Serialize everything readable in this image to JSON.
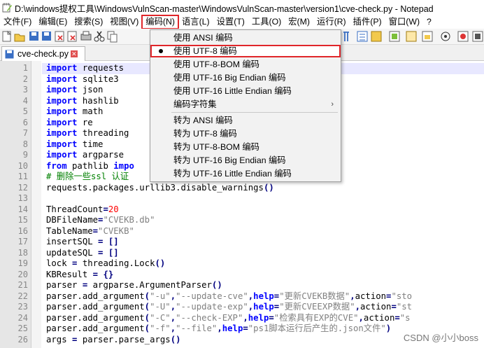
{
  "window": {
    "title": "D:\\windows提权工具\\WindowsVulnScan-master\\WindowsVulnScan-master\\version1\\cve-check.py - Notepad"
  },
  "menubar": {
    "items": [
      {
        "label": "文件(F)"
      },
      {
        "label": "编辑(E)"
      },
      {
        "label": "搜索(S)"
      },
      {
        "label": "视图(V)"
      },
      {
        "label": "编码(N)",
        "active": true
      },
      {
        "label": "语言(L)"
      },
      {
        "label": "设置(T)"
      },
      {
        "label": "工具(O)"
      },
      {
        "label": "宏(M)"
      },
      {
        "label": "运行(R)"
      },
      {
        "label": "插件(P)"
      },
      {
        "label": "窗口(W)"
      },
      {
        "label": "?"
      }
    ]
  },
  "tab": {
    "label": "cve-check.py",
    "close_glyph": "✕"
  },
  "encoding_menu": {
    "items": [
      {
        "label": "使用 ANSI 编码"
      },
      {
        "label": "使用 UTF-8 编码",
        "checked": true
      },
      {
        "label": "使用 UTF-8-BOM 编码"
      },
      {
        "label": "使用 UTF-16 Big Endian 编码"
      },
      {
        "label": "使用 UTF-16 Little Endian 编码"
      },
      {
        "label": "编码字符集",
        "submenu": true
      },
      {
        "label": "转为 ANSI 编码"
      },
      {
        "label": "转为 UTF-8 编码"
      },
      {
        "label": "转为 UTF-8-BOM 编码"
      },
      {
        "label": "转为 UTF-16 Big Endian 编码"
      },
      {
        "label": "转为 UTF-16 Little Endian 编码"
      }
    ],
    "submenu_arrow": "›"
  },
  "editor": {
    "line_numbers": [
      "1",
      "2",
      "3",
      "4",
      "5",
      "6",
      "7",
      "8",
      "9",
      "10",
      "11",
      "12",
      "13",
      "14",
      "15",
      "16",
      "17",
      "18",
      "19",
      "20",
      "21",
      "22",
      "23",
      "24",
      "25",
      "26"
    ],
    "lines": [
      [
        {
          "t": "import",
          "c": "kw"
        },
        {
          "t": " requests"
        }
      ],
      [
        {
          "t": "import",
          "c": "kw"
        },
        {
          "t": " sqlite3"
        }
      ],
      [
        {
          "t": "import",
          "c": "kw"
        },
        {
          "t": " json"
        }
      ],
      [
        {
          "t": "import",
          "c": "kw"
        },
        {
          "t": " hashlib"
        }
      ],
      [
        {
          "t": "import",
          "c": "kw"
        },
        {
          "t": " math"
        }
      ],
      [
        {
          "t": "import",
          "c": "kw"
        },
        {
          "t": " re"
        }
      ],
      [
        {
          "t": "import",
          "c": "kw"
        },
        {
          "t": " threading"
        }
      ],
      [
        {
          "t": "import",
          "c": "kw"
        },
        {
          "t": " time"
        }
      ],
      [
        {
          "t": "import",
          "c": "kw"
        },
        {
          "t": " argparse"
        }
      ],
      [
        {
          "t": "from",
          "c": "kw"
        },
        {
          "t": " pathlib "
        },
        {
          "t": "impo",
          "c": "kw"
        }
      ],
      [
        {
          "t": "# 删除一些ssl 认证",
          "c": "cmt"
        }
      ],
      [
        {
          "t": "requests.packages.urllib3.disable_warnings"
        },
        {
          "t": "()",
          "c": "op"
        }
      ],
      [],
      [
        {
          "t": "ThreadCount"
        },
        {
          "t": "=",
          "c": "op"
        },
        {
          "t": "20",
          "c": "num"
        }
      ],
      [
        {
          "t": "DBFileName"
        },
        {
          "t": "=",
          "c": "op"
        },
        {
          "t": "\"CVEKB.db\"",
          "c": "str"
        }
      ],
      [
        {
          "t": "TableName"
        },
        {
          "t": "=",
          "c": "op"
        },
        {
          "t": "\"CVEKB\"",
          "c": "str"
        }
      ],
      [
        {
          "t": "insertSQL "
        },
        {
          "t": "=",
          "c": "op"
        },
        {
          "t": " "
        },
        {
          "t": "[]",
          "c": "op"
        }
      ],
      [
        {
          "t": "updateSQL "
        },
        {
          "t": "=",
          "c": "op"
        },
        {
          "t": " "
        },
        {
          "t": "[]",
          "c": "op"
        }
      ],
      [
        {
          "t": "lock "
        },
        {
          "t": "=",
          "c": "op"
        },
        {
          "t": " threading.Lock"
        },
        {
          "t": "()",
          "c": "op"
        }
      ],
      [
        {
          "t": "KBResult "
        },
        {
          "t": "=",
          "c": "op"
        },
        {
          "t": " "
        },
        {
          "t": "{}",
          "c": "op"
        }
      ],
      [
        {
          "t": "parser "
        },
        {
          "t": "=",
          "c": "op"
        },
        {
          "t": " argparse.ArgumentParser"
        },
        {
          "t": "()",
          "c": "op"
        }
      ],
      [
        {
          "t": "parser.add_argument"
        },
        {
          "t": "(",
          "c": "op"
        },
        {
          "t": "\"-u\"",
          "c": "str"
        },
        {
          "t": ",",
          "c": "op"
        },
        {
          "t": "\"--update-cve\"",
          "c": "str"
        },
        {
          "t": ",",
          "c": "op"
        },
        {
          "t": "help",
          "c": "kw"
        },
        {
          "t": "=",
          "c": "op"
        },
        {
          "t": "\"更新CVEKB数据\"",
          "c": "str"
        },
        {
          "t": ",",
          "c": "op"
        },
        {
          "t": "action"
        },
        {
          "t": "=",
          "c": "op"
        },
        {
          "t": "\"sto",
          "c": "str"
        }
      ],
      [
        {
          "t": "parser.add_argument"
        },
        {
          "t": "(",
          "c": "op"
        },
        {
          "t": "\"-U\"",
          "c": "str"
        },
        {
          "t": ",",
          "c": "op"
        },
        {
          "t": "\"--update-exp\"",
          "c": "str"
        },
        {
          "t": ",",
          "c": "op"
        },
        {
          "t": "help",
          "c": "kw"
        },
        {
          "t": "=",
          "c": "op"
        },
        {
          "t": "\"更新CVEEXP数据\"",
          "c": "str"
        },
        {
          "t": ",",
          "c": "op"
        },
        {
          "t": "action"
        },
        {
          "t": "=",
          "c": "op"
        },
        {
          "t": "\"st",
          "c": "str"
        }
      ],
      [
        {
          "t": "parser.add_argument"
        },
        {
          "t": "(",
          "c": "op"
        },
        {
          "t": "\"-C\"",
          "c": "str"
        },
        {
          "t": ",",
          "c": "op"
        },
        {
          "t": "\"--check-EXP\"",
          "c": "str"
        },
        {
          "t": ",",
          "c": "op"
        },
        {
          "t": "help",
          "c": "kw"
        },
        {
          "t": "=",
          "c": "op"
        },
        {
          "t": "\"检索具有EXP的CVE\"",
          "c": "str"
        },
        {
          "t": ",",
          "c": "op"
        },
        {
          "t": "action"
        },
        {
          "t": "=",
          "c": "op"
        },
        {
          "t": "\"s",
          "c": "str"
        }
      ],
      [
        {
          "t": "parser.add_argument"
        },
        {
          "t": "(",
          "c": "op"
        },
        {
          "t": "\"-f\"",
          "c": "str"
        },
        {
          "t": ",",
          "c": "op"
        },
        {
          "t": "\"--file\"",
          "c": "str"
        },
        {
          "t": ",",
          "c": "op"
        },
        {
          "t": "help",
          "c": "kw"
        },
        {
          "t": "=",
          "c": "op"
        },
        {
          "t": "\"ps1脚本运行后产生的.json文件\"",
          "c": "str"
        },
        {
          "t": ")",
          "c": "op"
        }
      ],
      [
        {
          "t": "args "
        },
        {
          "t": "=",
          "c": "op"
        },
        {
          "t": " parser.parse_args"
        },
        {
          "t": "()",
          "c": "op"
        }
      ]
    ],
    "current_line_index": 0
  },
  "watermark": "CSDN @小小boss"
}
